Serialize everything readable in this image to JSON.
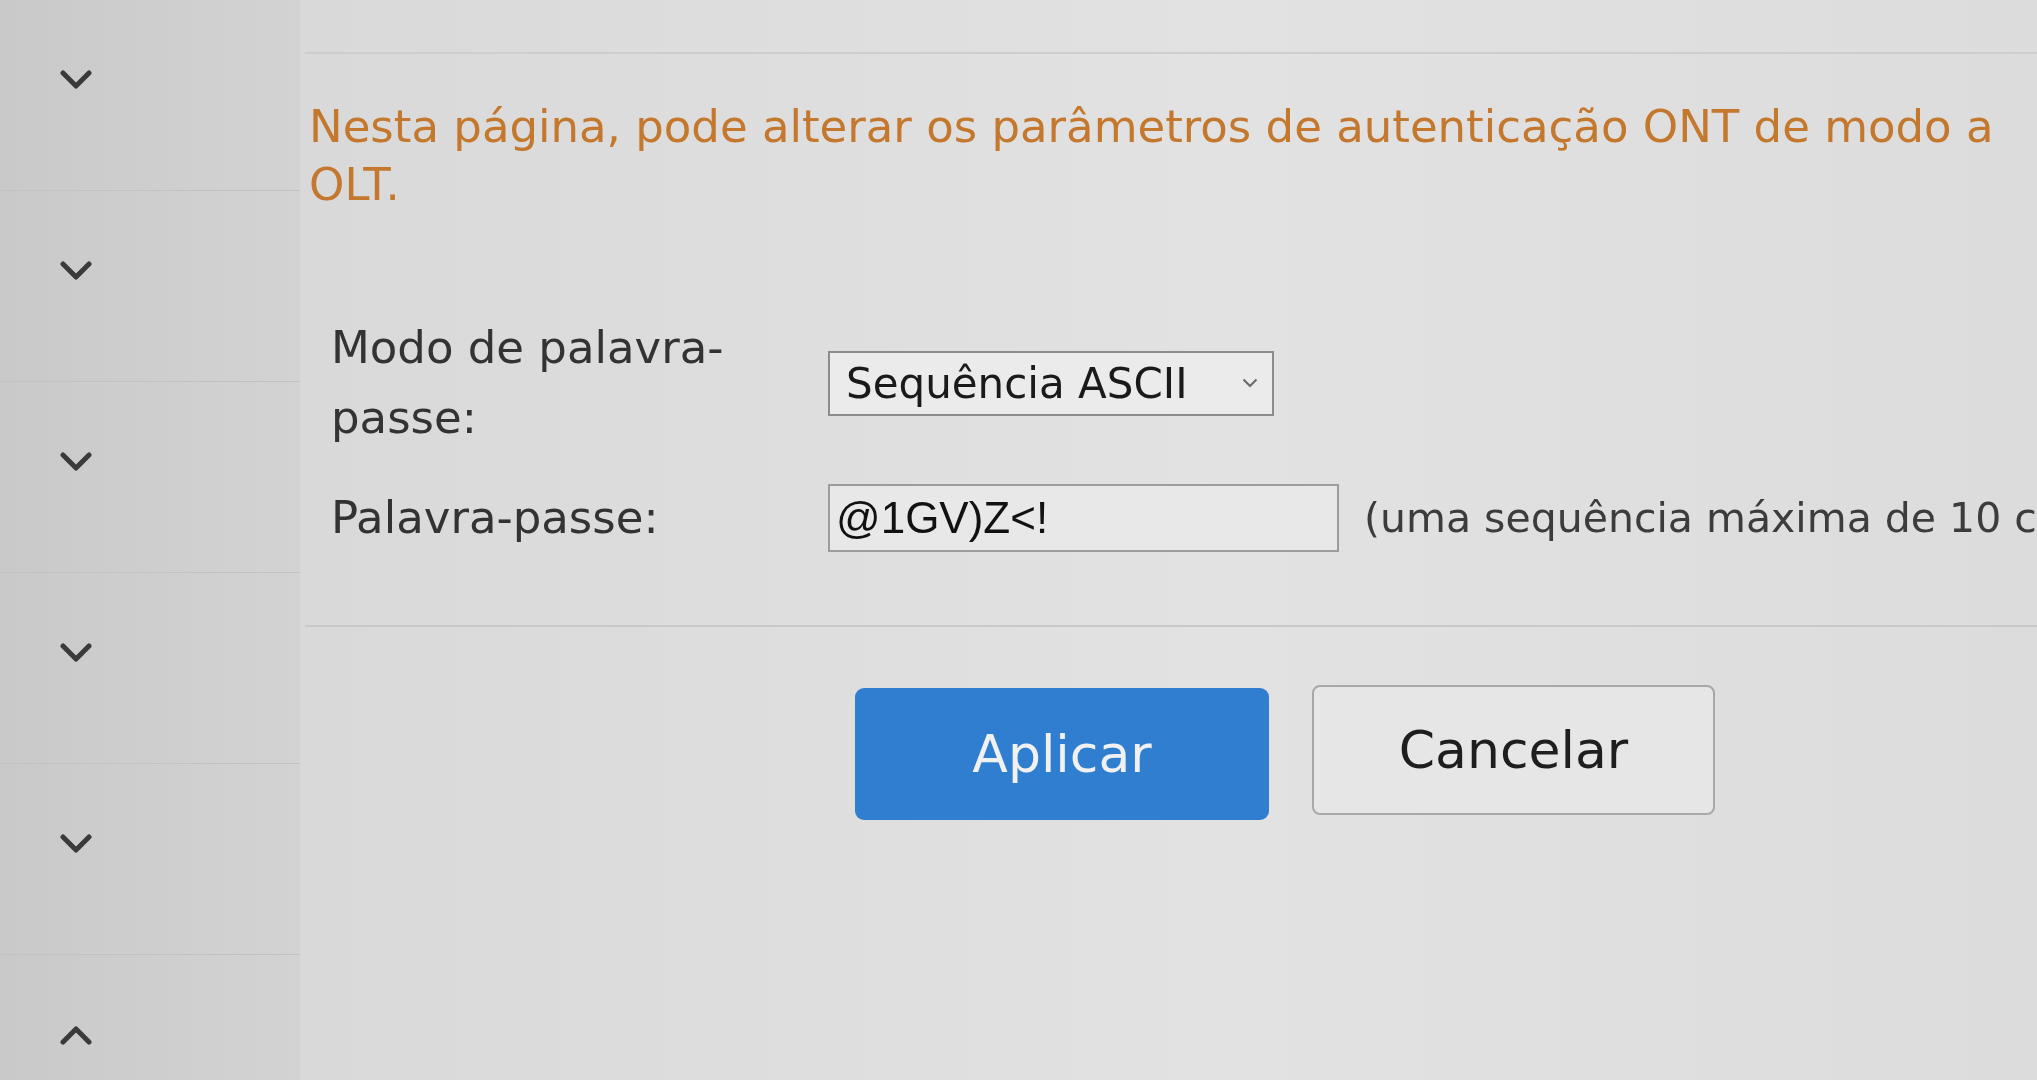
{
  "sidebar": {
    "items": [
      {
        "expanded": false
      },
      {
        "expanded": false
      },
      {
        "expanded": false
      },
      {
        "expanded": false
      },
      {
        "expanded": false
      },
      {
        "expanded": true
      }
    ]
  },
  "intro": {
    "lines": [
      "Nesta página, pode alterar os parâmetros de autenticação ONT de modo a",
      "OLT."
    ]
  },
  "form": {
    "fields": [
      {
        "kind": "select",
        "label": "Modo de palavra-passe:",
        "value": "Sequência ASCII"
      },
      {
        "kind": "text",
        "label": "Palavra-passe:",
        "value": "@1GV)Z<!",
        "hint": "(uma sequência máxima de 10 c"
      }
    ]
  },
  "buttons": [
    {
      "label": "Aplicar",
      "kind": "primary"
    },
    {
      "label": "Cancelar",
      "kind": "secondary"
    }
  ]
}
